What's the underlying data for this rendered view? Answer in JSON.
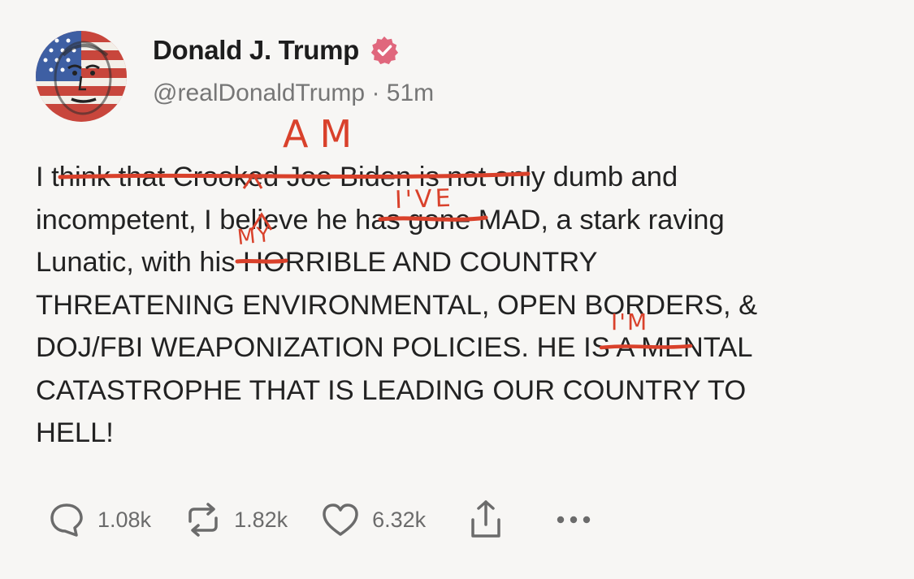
{
  "post": {
    "author": {
      "display_name": "Donald J. Trump",
      "handle": "@realDonaldTrump",
      "separator": " · ",
      "time_ago": "51m",
      "avatar_icon": "flag-painted-face-avatar",
      "verified_icon": "verified-badge-icon",
      "verified_color": "#e0677d"
    },
    "text_lines": [
      [
        {
          "text": "I ",
          "struck": false
        },
        {
          "text": "think that Crooked Joe Biden is",
          "struck": true
        },
        {
          "text": " not only dumb and",
          "struck": false
        }
      ],
      [
        {
          "text": "incompetent, I believe ",
          "struck": false
        },
        {
          "text": "he has",
          "struck": true
        },
        {
          "text": " gone MAD, a stark raving",
          "struck": false
        }
      ],
      [
        {
          "text": "Lunatic, with ",
          "struck": false
        },
        {
          "text": "his",
          "struck": true
        },
        {
          "text": " HORRIBLE AND COUNTRY",
          "struck": false
        }
      ],
      [
        {
          "text": "THREATENING ENVIRONMENTAL, OPEN BORDERS, &",
          "struck": false
        }
      ],
      [
        {
          "text": "DOJ/FBI WEAPONIZATION POLICIES. ",
          "struck": false
        },
        {
          "text": "HE IS",
          "struck": true
        },
        {
          "text": " A MENTAL",
          "struck": false
        }
      ],
      [
        {
          "text": "CATASTROPHE THAT IS LEADING OUR COUNTRY TO",
          "struck": false
        }
      ],
      [
        {
          "text": "HELL!",
          "struck": false
        }
      ]
    ],
    "handwritten_edits": {
      "am": "AM",
      "ive": "I'VE",
      "my": "MY",
      "im": "I'M",
      "ink_color": "#d9412b"
    },
    "actions": [
      {
        "icon": "reply-bubble-icon",
        "count": "1.08k"
      },
      {
        "icon": "retweet-icon",
        "count": "1.82k"
      },
      {
        "icon": "heart-icon",
        "count": "6.32k"
      },
      {
        "icon": "share-icon",
        "count": ""
      },
      {
        "icon": "more-dots-icon",
        "count": ""
      }
    ]
  }
}
